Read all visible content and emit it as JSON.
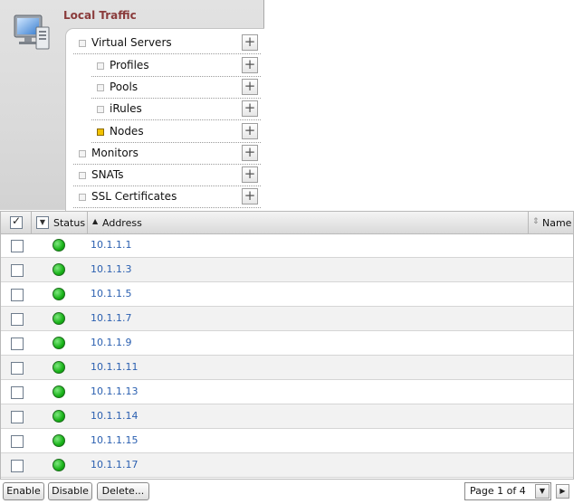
{
  "nav": {
    "title": "Local Traffic",
    "icon": "local-traffic-icon",
    "items": [
      {
        "label": "Virtual Servers",
        "level": 0,
        "active": false
      },
      {
        "label": "Profiles",
        "level": 1,
        "active": false
      },
      {
        "label": "Pools",
        "level": 1,
        "active": false
      },
      {
        "label": "iRules",
        "level": 1,
        "active": false
      },
      {
        "label": "Nodes",
        "level": 1,
        "active": true
      },
      {
        "label": "Monitors",
        "level": 0,
        "active": false
      },
      {
        "label": "SNATs",
        "level": 0,
        "active": false
      },
      {
        "label": "SSL Certificates",
        "level": 0,
        "active": false
      }
    ],
    "add_symbol": "+"
  },
  "table": {
    "columns": {
      "status": "Status",
      "address": "Address",
      "name": "Name"
    },
    "sort_column": "Address",
    "rows": [
      {
        "address": "10.1.1.1",
        "status": "green",
        "name": ""
      },
      {
        "address": "10.1.1.3",
        "status": "green",
        "name": ""
      },
      {
        "address": "10.1.1.5",
        "status": "green",
        "name": ""
      },
      {
        "address": "10.1.1.7",
        "status": "green",
        "name": ""
      },
      {
        "address": "10.1.1.9",
        "status": "green",
        "name": ""
      },
      {
        "address": "10.1.1.11",
        "status": "green",
        "name": ""
      },
      {
        "address": "10.1.1.13",
        "status": "green",
        "name": ""
      },
      {
        "address": "10.1.1.14",
        "status": "green",
        "name": ""
      },
      {
        "address": "10.1.1.15",
        "status": "green",
        "name": ""
      },
      {
        "address": "10.1.1.17",
        "status": "green",
        "name": ""
      }
    ]
  },
  "footer": {
    "enable": "Enable",
    "disable": "Disable",
    "delete": "Delete...",
    "page_select": "Page 1 of 4"
  },
  "colors": {
    "nav_title": "#8a3b3b",
    "link": "#2a5fb0",
    "status_ok": "#18b218",
    "active_bullet": "#f2c200"
  }
}
